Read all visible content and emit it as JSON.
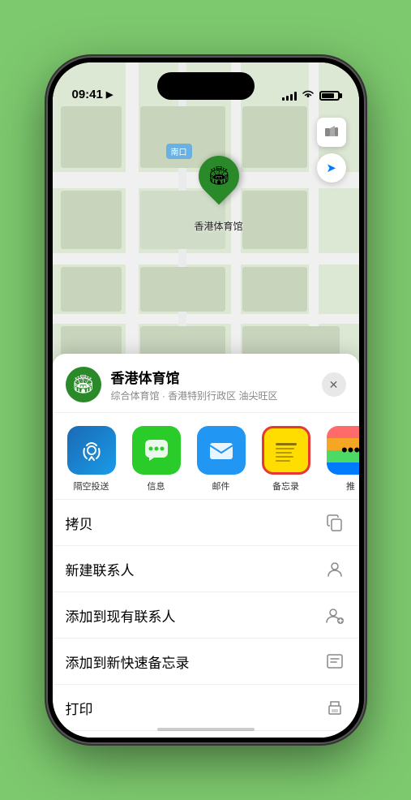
{
  "status_bar": {
    "time": "09:41",
    "location_arrow": "▶"
  },
  "map": {
    "entrance_label": "南口",
    "pin_label": "香港体育馆"
  },
  "location_card": {
    "icon": "🏟",
    "name": "香港体育馆",
    "subtitle": "综合体育馆 · 香港特别行政区 油尖旺区",
    "close_label": "✕"
  },
  "share_items": [
    {
      "id": "airdrop",
      "label": "隔空投送",
      "icon_text": "📡"
    },
    {
      "id": "message",
      "label": "信息",
      "icon_text": "💬"
    },
    {
      "id": "mail",
      "label": "邮件",
      "icon_text": "✉"
    },
    {
      "id": "notes",
      "label": "备忘录",
      "icon_text": "notes"
    },
    {
      "id": "more",
      "label": "推",
      "icon_text": "more"
    }
  ],
  "menu_items": [
    {
      "label": "拷贝",
      "icon": "copy"
    },
    {
      "label": "新建联系人",
      "icon": "person"
    },
    {
      "label": "添加到现有联系人",
      "icon": "person-add"
    },
    {
      "label": "添加到新快速备忘录",
      "icon": "note"
    },
    {
      "label": "打印",
      "icon": "print"
    }
  ],
  "colors": {
    "selected_border": "#e53935",
    "pin_green": "#2a8a2a",
    "airdrop_blue": "#1a9be8",
    "message_green": "#2acc2a",
    "mail_blue": "#2196f3",
    "notes_yellow": "#ffdd00"
  }
}
